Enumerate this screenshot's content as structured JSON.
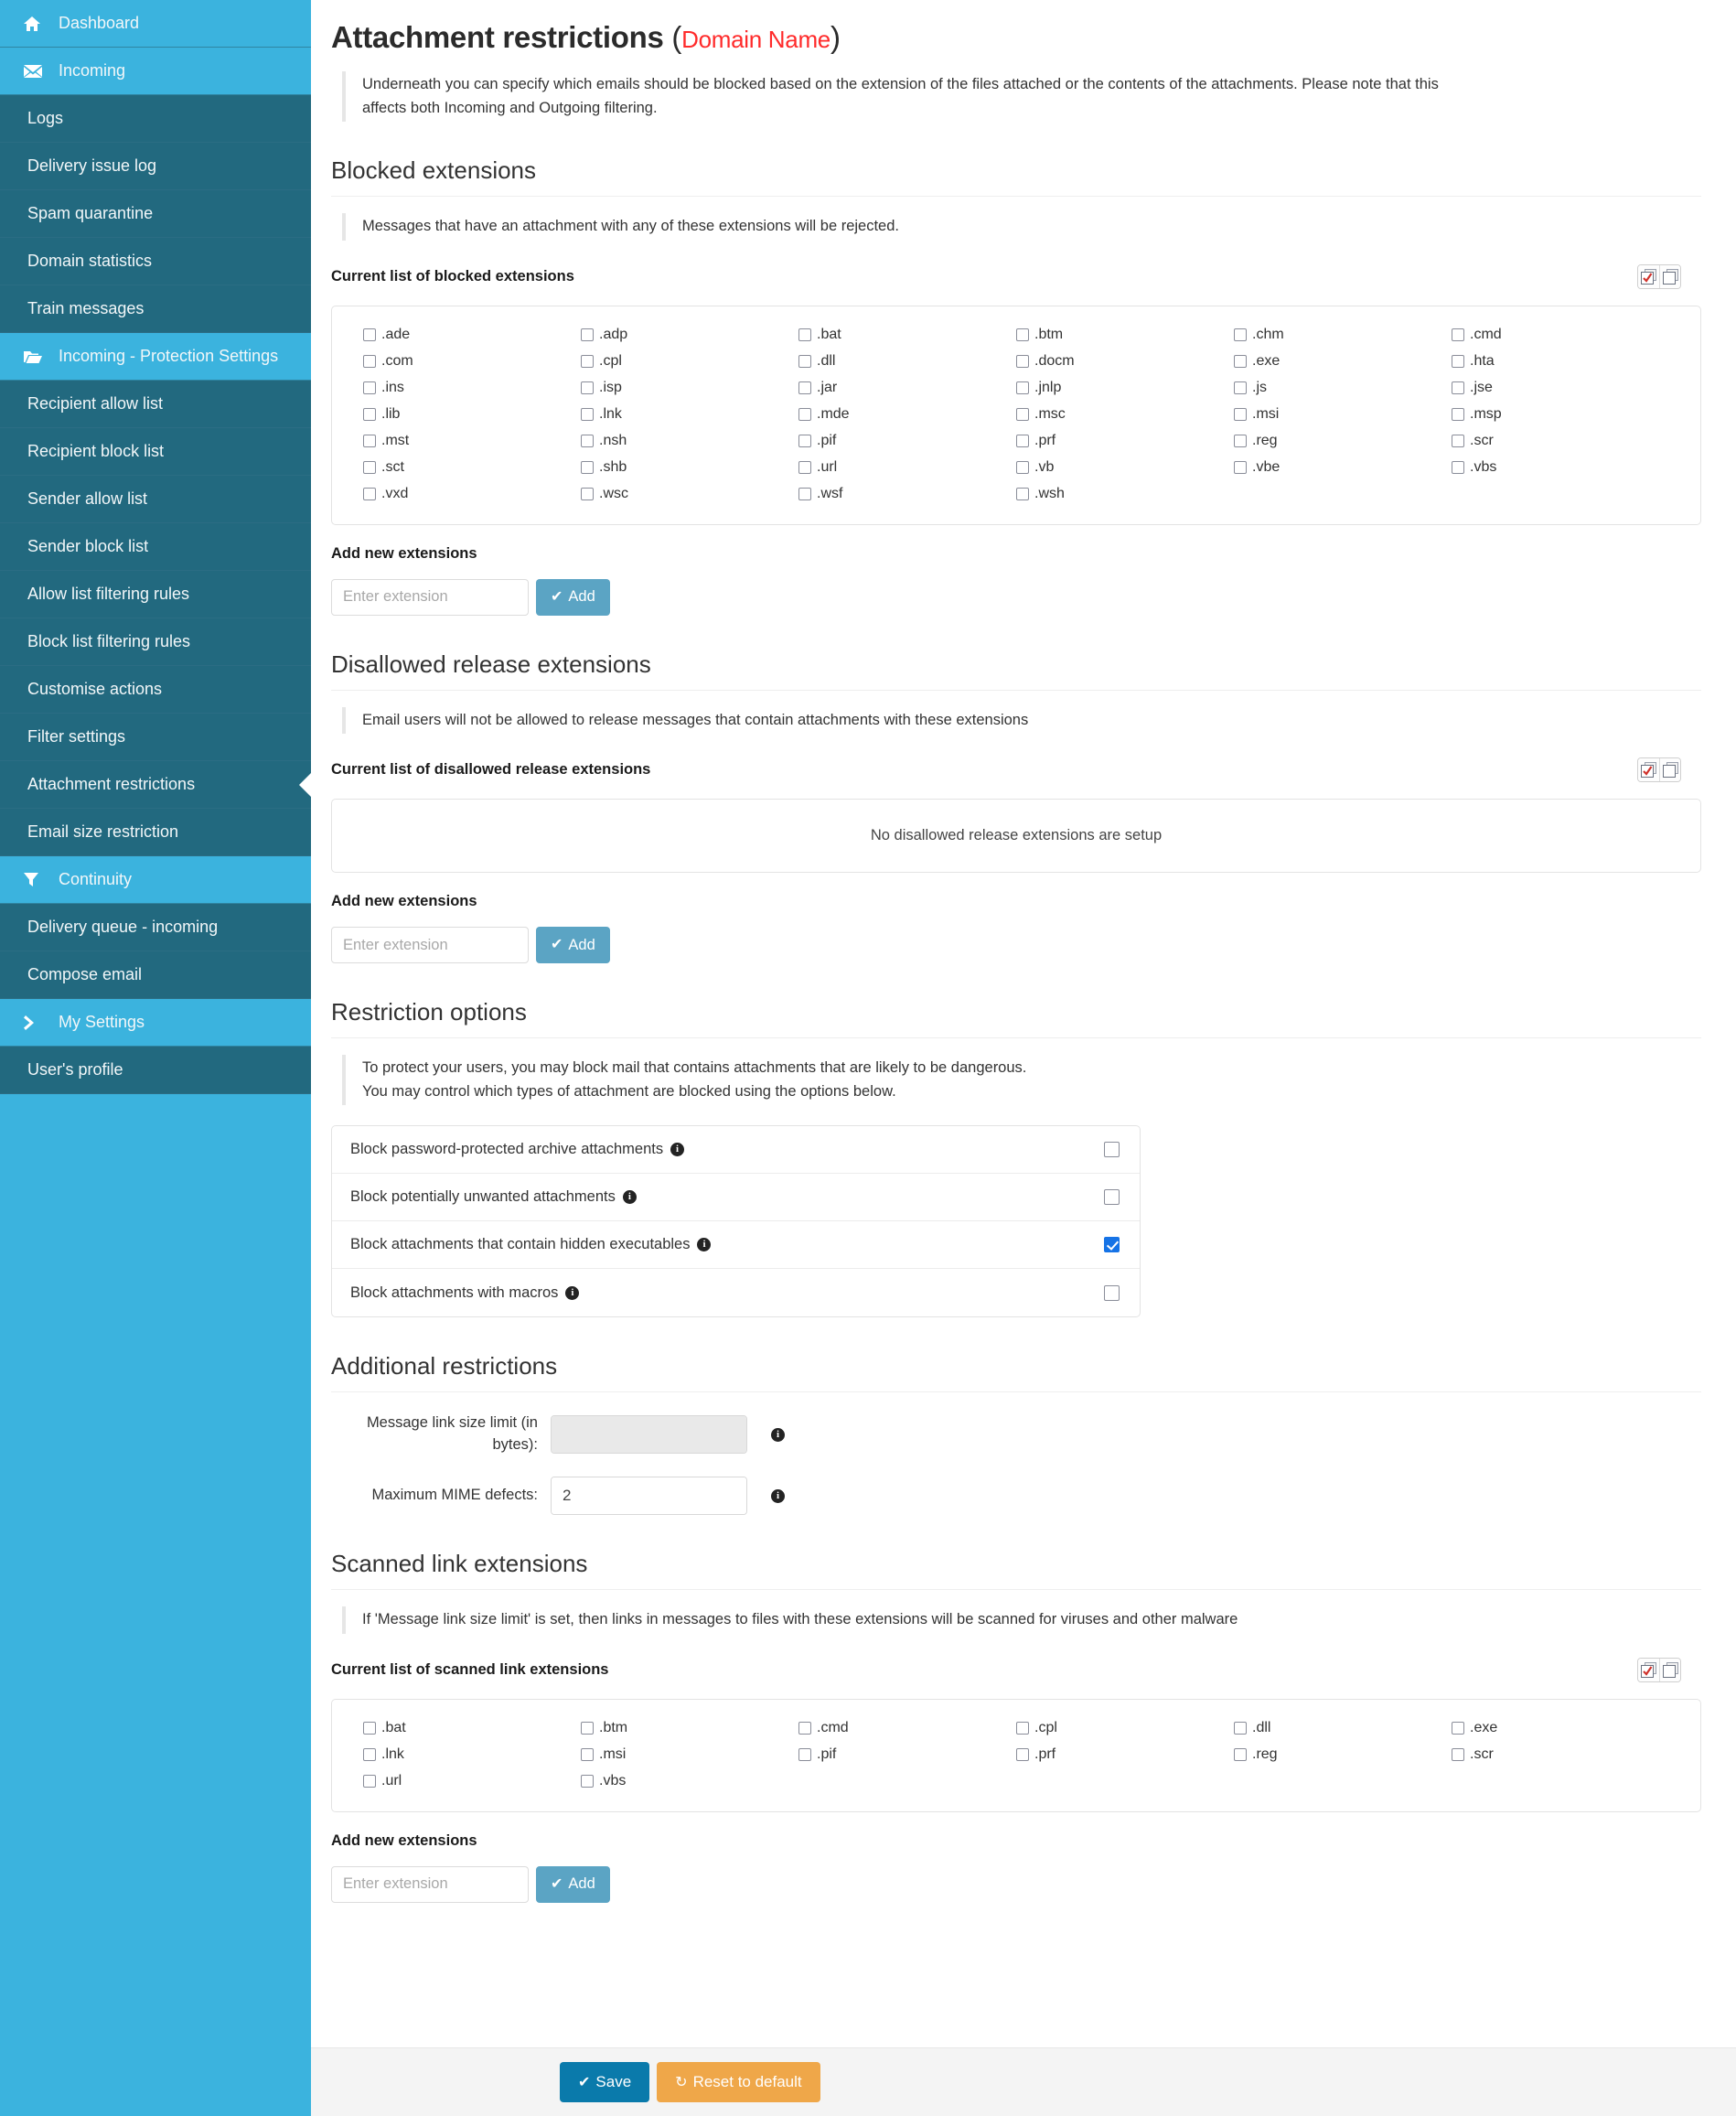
{
  "sidebar": {
    "items": [
      {
        "label": "Dashboard",
        "icon": "home-icon",
        "type": "group",
        "active": true
      },
      {
        "label": "Incoming",
        "icon": "envelope-icon",
        "type": "group",
        "active": true
      },
      {
        "label": "Logs",
        "type": "sub"
      },
      {
        "label": "Delivery issue log",
        "type": "sub"
      },
      {
        "label": "Spam quarantine",
        "type": "sub"
      },
      {
        "label": "Domain statistics",
        "type": "sub"
      },
      {
        "label": "Train messages",
        "type": "sub"
      },
      {
        "label": "Incoming - Protection Settings",
        "icon": "folder-icon",
        "type": "group",
        "active": true
      },
      {
        "label": "Recipient allow list",
        "type": "sub"
      },
      {
        "label": "Recipient block list",
        "type": "sub"
      },
      {
        "label": "Sender allow list",
        "type": "sub"
      },
      {
        "label": "Sender block list",
        "type": "sub"
      },
      {
        "label": "Allow list filtering rules",
        "type": "sub"
      },
      {
        "label": "Block list filtering rules",
        "type": "sub"
      },
      {
        "label": "Customise actions",
        "type": "sub"
      },
      {
        "label": "Filter settings",
        "type": "sub"
      },
      {
        "label": "Attachment restrictions",
        "type": "sub",
        "selected": true
      },
      {
        "label": "Email size restriction",
        "type": "sub"
      },
      {
        "label": "Continuity",
        "icon": "filter-icon",
        "type": "group",
        "active": true
      },
      {
        "label": "Delivery queue - incoming",
        "type": "sub"
      },
      {
        "label": "Compose email",
        "type": "sub"
      },
      {
        "label": "My Settings",
        "icon": "chevron-right-icon",
        "type": "group",
        "active": true
      },
      {
        "label": "User's profile",
        "type": "sub"
      }
    ]
  },
  "page": {
    "title": "Attachment restrictions",
    "paren_open": "(",
    "domain": "Domain Name",
    "paren_close": ")",
    "intro": "Underneath you can specify which emails should be blocked based on the extension of the files attached or the contents of the attachments. Please note that this affects both Incoming and Outgoing filtering."
  },
  "blocked": {
    "section_title": "Blocked extensions",
    "note": "Messages that have an attachment with any of these extensions will be rejected.",
    "list_label": "Current list of blocked extensions",
    "extensions": [
      ".ade",
      ".adp",
      ".bat",
      ".btm",
      ".chm",
      ".cmd",
      ".com",
      ".cpl",
      ".dll",
      ".docm",
      ".exe",
      ".hta",
      ".ins",
      ".isp",
      ".jar",
      ".jnlp",
      ".js",
      ".jse",
      ".lib",
      ".lnk",
      ".mde",
      ".msc",
      ".msi",
      ".msp",
      ".mst",
      ".nsh",
      ".pif",
      ".prf",
      ".reg",
      ".scr",
      ".sct",
      ".shb",
      ".url",
      ".vb",
      ".vbe",
      ".vbs",
      ".vxd",
      ".wsc",
      ".wsf",
      ".wsh"
    ],
    "add_label": "Add new extensions",
    "add_placeholder": "Enter extension",
    "add_button": "Add"
  },
  "disallowed": {
    "section_title": "Disallowed release extensions",
    "note": "Email users will not be allowed to release messages that contain attachments with these extensions",
    "list_label": "Current list of disallowed release extensions",
    "empty_message": "No disallowed release extensions are setup",
    "add_label": "Add new extensions",
    "add_placeholder": "Enter extension",
    "add_button": "Add"
  },
  "restriction_options": {
    "section_title": "Restriction options",
    "note_line1": "To protect your users, you may block mail that contains attachments that are likely to be dangerous.",
    "note_line2": "You may control which types of attachment are blocked using the options below.",
    "options": [
      {
        "label": "Block password-protected archive attachments",
        "checked": false
      },
      {
        "label": "Block potentially unwanted attachments",
        "checked": false
      },
      {
        "label": "Block attachments that contain hidden executables",
        "checked": true
      },
      {
        "label": "Block attachments with macros",
        "checked": false
      }
    ]
  },
  "additional": {
    "section_title": "Additional restrictions",
    "fields": [
      {
        "label": "Message link size limit (in bytes):",
        "value": "",
        "checked": false,
        "disabled": true
      },
      {
        "label": "Maximum MIME defects:",
        "value": "2",
        "checked": true,
        "disabled": false
      }
    ]
  },
  "scanned": {
    "section_title": "Scanned link extensions",
    "note": "If 'Message link size limit' is set, then links in messages to files with these extensions will be scanned for viruses and other malware",
    "list_label": "Current list of scanned link extensions",
    "extensions": [
      ".bat",
      ".btm",
      ".cmd",
      ".cpl",
      ".dll",
      ".exe",
      ".lnk",
      ".msi",
      ".pif",
      ".prf",
      ".reg",
      ".scr",
      ".url",
      ".vbs"
    ],
    "add_label": "Add new extensions",
    "add_placeholder": "Enter extension",
    "add_button": "Add"
  },
  "footer": {
    "save_label": "Save",
    "reset_label": "Reset to default"
  },
  "colors": {
    "sidebar_light": "#3BB3DE",
    "sidebar_dark": "#22697F",
    "accent_red": "#FF2B2B",
    "checkbox_blue": "#1673E6",
    "save_blue": "#0A7AAB",
    "reset_orange": "#EFA749",
    "add_blue": "#5BA4C4"
  }
}
